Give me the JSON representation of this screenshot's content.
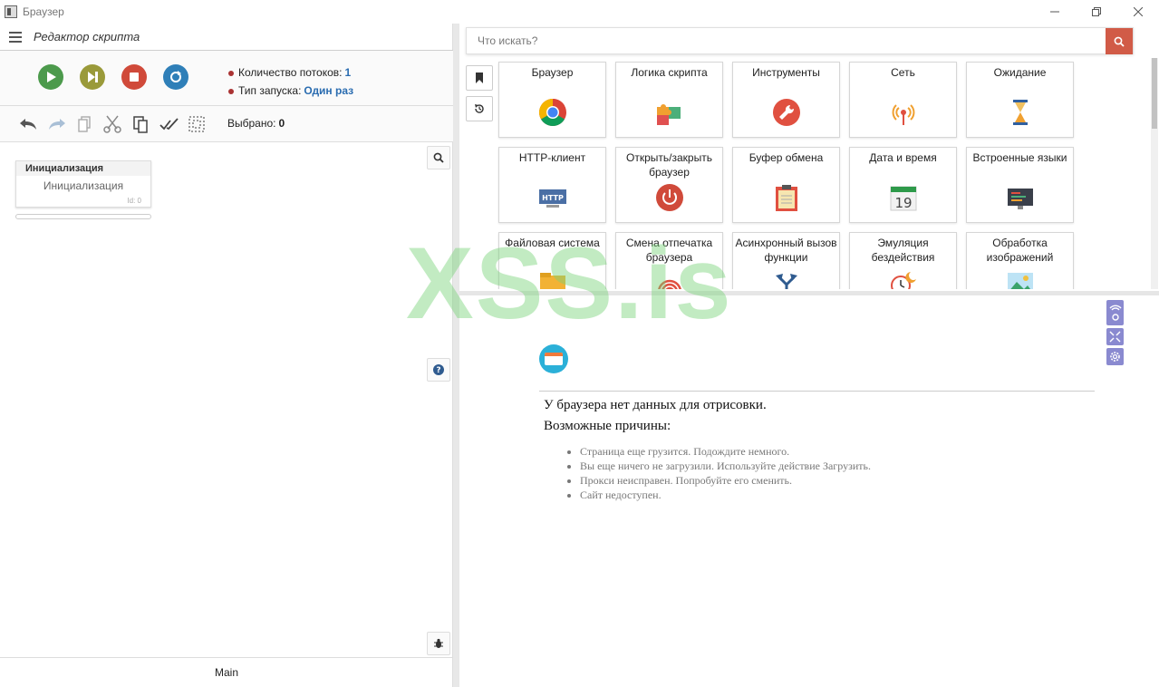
{
  "window": {
    "title": "Браузер"
  },
  "editor": {
    "title": "Редактор скрипта"
  },
  "run": {
    "threads_label": "Количество потоков:",
    "threads_value": "1",
    "launch_label": "Тип запуска:",
    "launch_value": "Один раз"
  },
  "edit": {
    "selected_label": "Выбрано:",
    "selected_value": "0"
  },
  "block": {
    "header": "Инициализация",
    "body": "Инициализация",
    "id": "Id: 0"
  },
  "footer": {
    "tab": "Main"
  },
  "search": {
    "placeholder": "Что искать?"
  },
  "tiles": [
    {
      "label": "Браузер"
    },
    {
      "label": "Логика скрипта"
    },
    {
      "label": "Инструменты"
    },
    {
      "label": "Сеть"
    },
    {
      "label": "Ожидание"
    },
    {
      "label": "HTTP-клиент",
      "icon_text": "HTTP"
    },
    {
      "label": "Открыть/закрыть браузер"
    },
    {
      "label": "Буфер обмена"
    },
    {
      "label": "Дата и время",
      "icon_text": "19"
    },
    {
      "label": "Встроенные языки"
    },
    {
      "label": "Файловая система"
    },
    {
      "label": "Смена отпечатка браузера"
    },
    {
      "label": "Асинхронный вызов функции"
    },
    {
      "label": "Эмуляция бездействия"
    },
    {
      "label": "Обработка изображений"
    }
  ],
  "browser": {
    "no_data": "У браузера нет данных для отрисовки.",
    "reasons_title": "Возможные причины:",
    "reasons": [
      "Страница еще грузится. Подождите немного.",
      "Вы еще ничего не загрузили. Используйте действие Загрузить.",
      "Прокси неисправен. Попробуйте его сменить.",
      "Сайт недоступен."
    ]
  },
  "watermark": "XSS.is",
  "colors": {
    "accent": "#d15b47",
    "link": "#2a6cb0",
    "play": "#4c9a4c",
    "step": "#9a9a3a",
    "stop": "#d04a3a",
    "restart": "#2f7fb8"
  }
}
